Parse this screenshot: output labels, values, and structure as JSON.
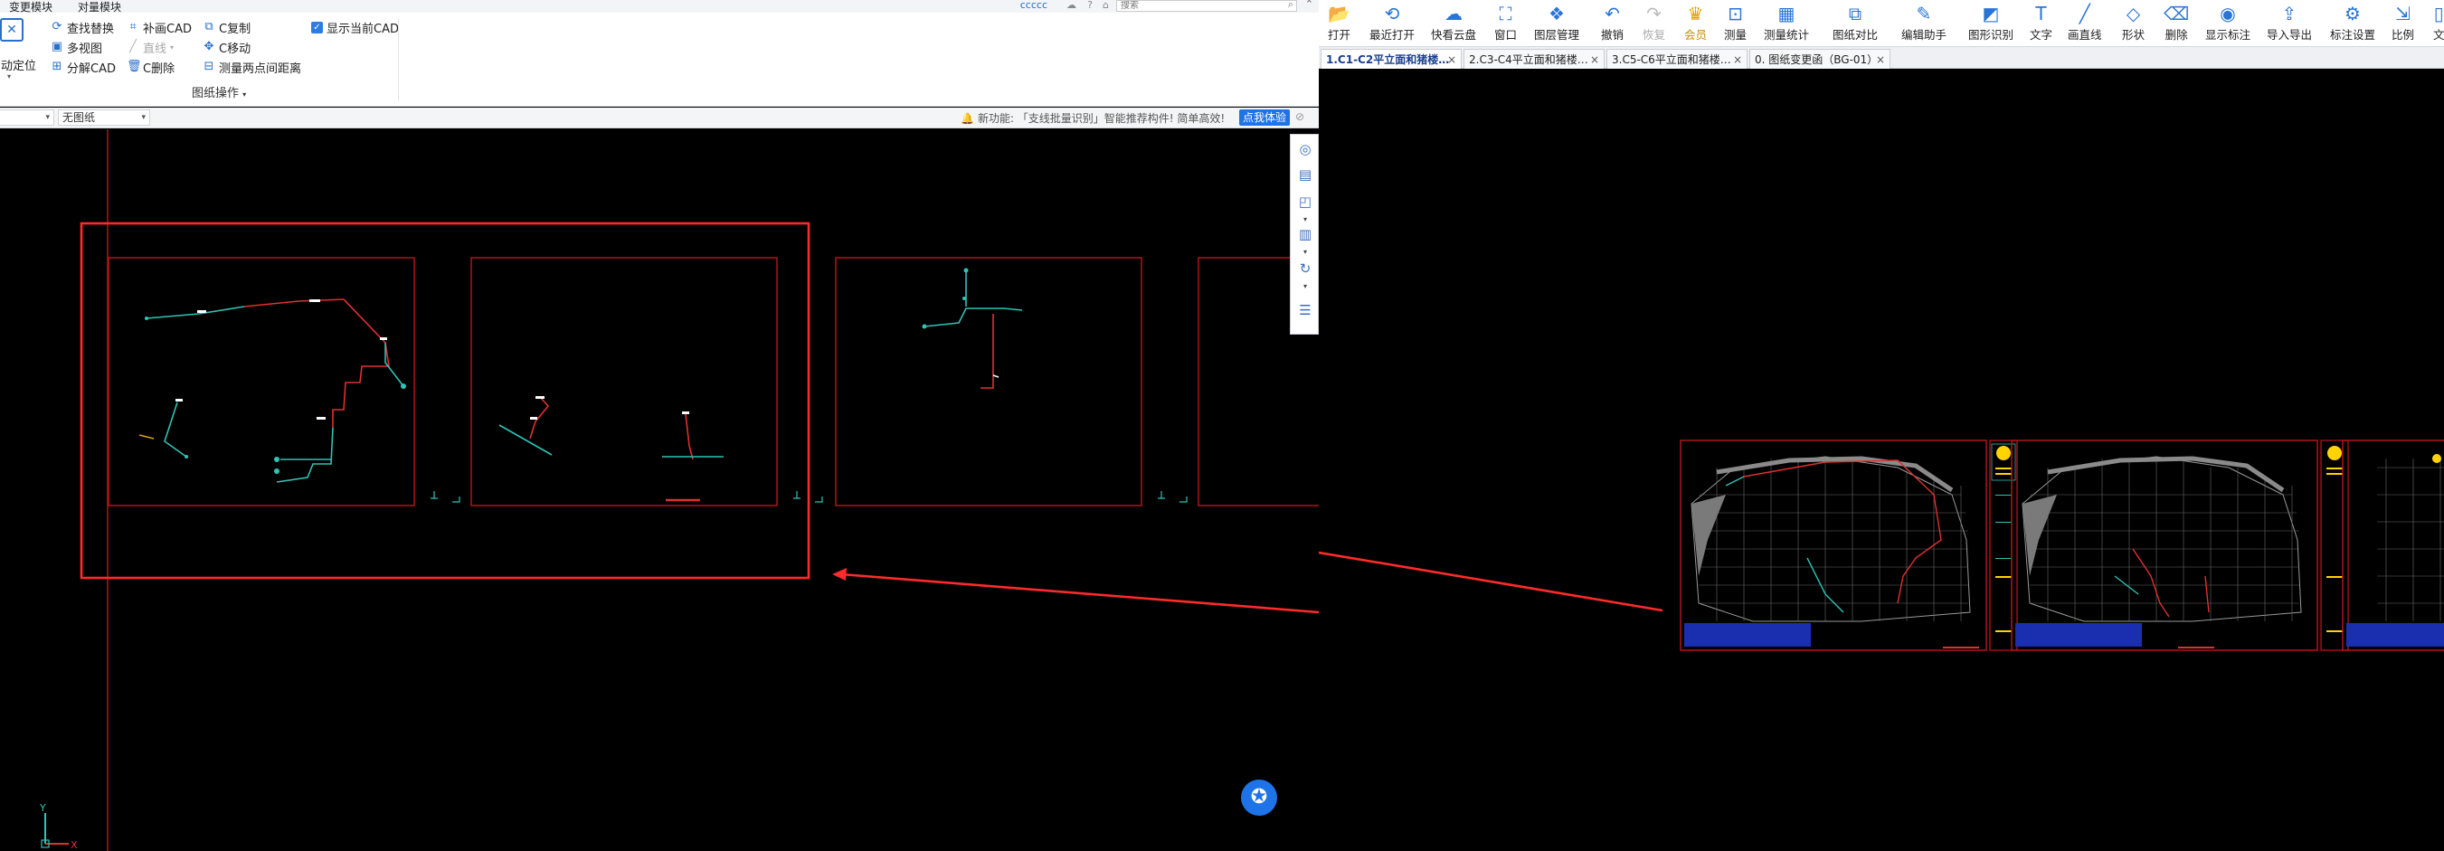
{
  "left_app": {
    "ribbon_tabs": [
      "变更模块",
      "对量模块"
    ],
    "title_user": "ccccc",
    "search_placeholder": "搜索",
    "ribbon": {
      "auto_locate": "自动定位",
      "find_replace": "查找替换",
      "multi_view": "多视图",
      "split_cad": "分解CAD",
      "supplement_cad": "补画CAD",
      "line": "直线",
      "c_delete": "C删除",
      "c_copy": "C复制",
      "c_move": "C移动",
      "measure_distance": "测量两点间距离",
      "show_current_cad": "显示当前CAD",
      "group_label": "图纸操作"
    },
    "subbar": {
      "left_value": "",
      "drawing_select": "无图纸",
      "notice": "新功能: 「支线批量识别」智能推荐构件! 简单高效!",
      "try_button": "点我体验"
    }
  },
  "right_app": {
    "toolbar": [
      "打开",
      "最近打开",
      "快看云盘",
      "窗口",
      "图层管理",
      "撤销",
      "恢复",
      "会员",
      "测量",
      "测量统计",
      "图纸对比",
      "编辑助手",
      "图形识别",
      "文字",
      "画直线",
      "形状",
      "删除",
      "显示标注",
      "导入导出",
      "标注设置",
      "比例",
      "文"
    ],
    "doc_tabs": [
      {
        "label": "1.C1-C2平立面和猪楼…",
        "active": true
      },
      {
        "label": "2.C3-C4平立面和猪楼…",
        "active": false
      },
      {
        "label": "3.C5-C6平立面和猪楼…",
        "active": false
      },
      {
        "label": "0. 图纸变更函（BG-01）",
        "active": false
      }
    ]
  },
  "colors": {
    "accent": "#1f73e8",
    "highlight_red": "#ff2a2a",
    "frame_red": "#c0141e",
    "pipe_cyan": "#2ec4b6",
    "pipe_red": "#e03030"
  },
  "icons": {
    "fab": "star-badge-icon",
    "axis": "ucs-axis-icon"
  }
}
